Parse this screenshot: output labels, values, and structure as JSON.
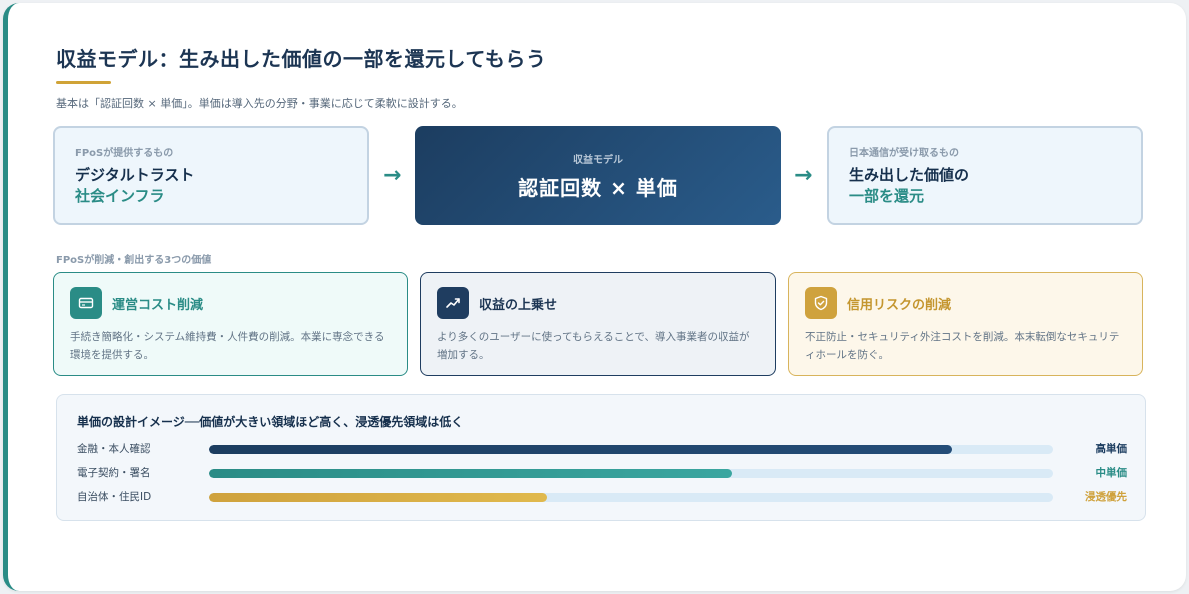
{
  "header": {
    "title": "収益モデル：生み出した価値の一部を還元してもらう",
    "subtitle": "基本は「認証回数 × 単価」。単価は導入先の分野・事業に応じて柔軟に設計する。"
  },
  "flow": {
    "left": {
      "caption": "FPoSが提供するもの",
      "line1": "デジタルトラスト",
      "line2": "社会インフラ"
    },
    "center": {
      "caption": "収益モデル",
      "main": "認証回数 × 単価"
    },
    "right": {
      "caption": "日本通信が受け取るもの",
      "line1": "生み出した価値の",
      "line2": "一部を還元"
    },
    "arrow": "→"
  },
  "values_section": {
    "label": "FPoSが削減・創出する3つの価値",
    "cards": [
      {
        "icon": "credit-card-icon",
        "title": "運営コスト削減",
        "desc": "手続き簡略化・システム維持費・人件費の削減。本業に専念できる環境を提供する。"
      },
      {
        "icon": "trend-up-icon",
        "title": "収益の上乗せ",
        "desc": "より多くのユーザーに使ってもらえることで、導入事業者の収益が増加する。"
      },
      {
        "icon": "shield-check-icon",
        "title": "信用リスクの削減",
        "desc": "不正防止・セキュリティ外注コストを削減。本末転倒なセキュリティホールを防ぐ。"
      }
    ]
  },
  "price_design": {
    "title": "単価の設計イメージ──価値が大きい領域ほど高く、浸透優先領域は低く",
    "rows": [
      {
        "label": "金融・本人確認",
        "level": 0.88,
        "tag": "高単価",
        "color": "#1c3d60"
      },
      {
        "label": "電子契約・署名",
        "level": 0.62,
        "tag": "中単価",
        "color": "#2a8c86"
      },
      {
        "label": "自治体・住民ID",
        "level": 0.4,
        "tag": "浸透優先",
        "color": "#cfa23d"
      }
    ]
  },
  "colors": {
    "accent_teal": "#2a8c86",
    "navy": "#1c3d60",
    "gold": "#cfa23d"
  }
}
